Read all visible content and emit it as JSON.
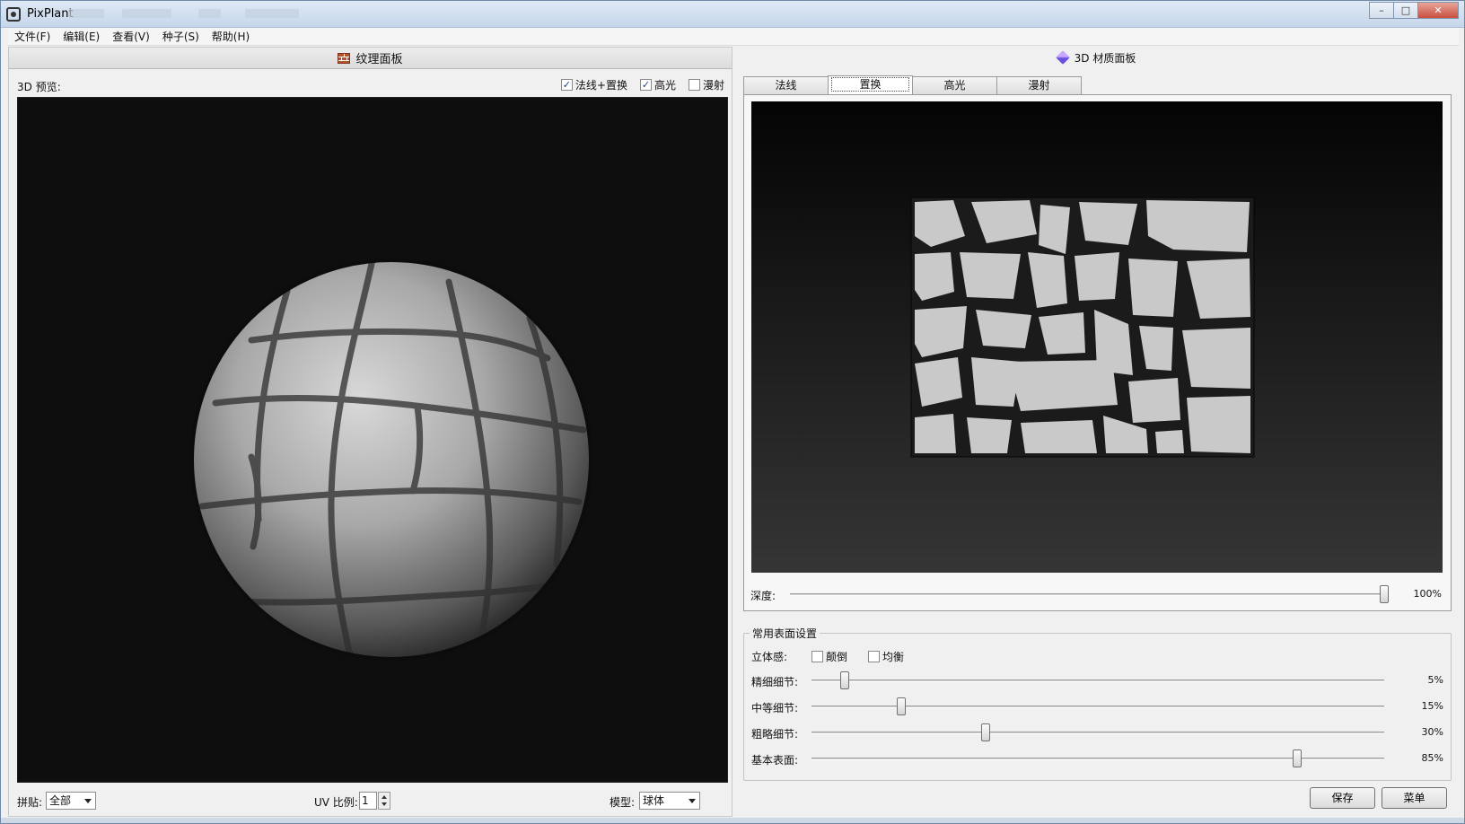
{
  "window": {
    "title": "PixPlant",
    "controls": {
      "minimize": "–",
      "maximize": "□",
      "close": "✕"
    }
  },
  "menu": [
    {
      "label": "文件(F)"
    },
    {
      "label": "编辑(E)"
    },
    {
      "label": "查看(V)"
    },
    {
      "label": "种子(S)"
    },
    {
      "label": "帮助(H)"
    }
  ],
  "texture_panel": {
    "header": "纹理面板",
    "preview_label": "3D 预览:",
    "options": [
      {
        "label": "法线+置换",
        "checked": true
      },
      {
        "label": "高光",
        "checked": true
      },
      {
        "label": "漫射",
        "checked": false
      }
    ],
    "bottom": {
      "tile_label": "拼贴:",
      "tile_value": "全部",
      "uv_label": "UV 比例:",
      "uv_value": "1",
      "model_label": "模型:",
      "model_value": "球体"
    }
  },
  "material_panel": {
    "header": "3D 材质面板",
    "tabs": [
      {
        "label": "法线",
        "active": false
      },
      {
        "label": "置换",
        "active": true
      },
      {
        "label": "高光",
        "active": false
      },
      {
        "label": "漫射",
        "active": false
      }
    ],
    "depth": {
      "label": "深度:",
      "value_text": "100%",
      "value": 1.0
    },
    "surface_settings": {
      "title": "常用表面设置",
      "relief_label": "立体感:",
      "relief_options": [
        {
          "label": "颠倒",
          "checked": false
        },
        {
          "label": "均衡",
          "checked": false
        }
      ],
      "sliders": [
        {
          "label": "精细细节:",
          "value_text": "5%",
          "value": 0.05
        },
        {
          "label": "中等细节:",
          "value_text": "15%",
          "value": 0.15
        },
        {
          "label": "粗略细节:",
          "value_text": "30%",
          "value": 0.3
        },
        {
          "label": "基本表面:",
          "value_text": "85%",
          "value": 0.85
        }
      ]
    },
    "buttons": {
      "save": "保存",
      "menu": "菜单"
    }
  }
}
